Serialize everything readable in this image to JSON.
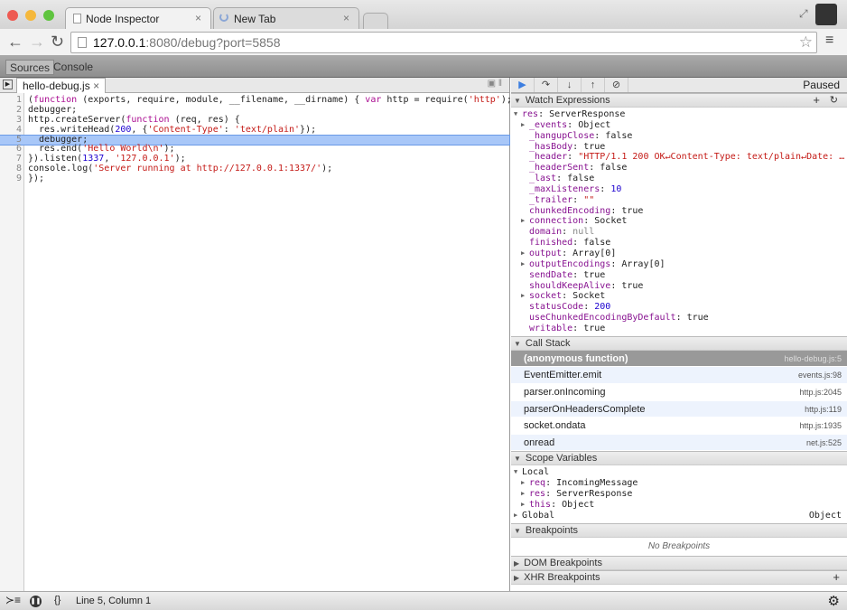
{
  "browser": {
    "tabs": [
      {
        "label": "Node Inspector",
        "active": true
      },
      {
        "label": "New Tab",
        "active": false
      }
    ],
    "url_host": "127.0.0.1",
    "url_rest": ":8080/debug?port=5858"
  },
  "devtools": {
    "panels": [
      "Sources",
      "Console"
    ],
    "file_tab": "hello-debug.js",
    "code": [
      [
        [
          "(",
          "p"
        ],
        [
          "function",
          "kw"
        ],
        [
          " (exports, require, module, __filename, __dirname) { ",
          "p"
        ],
        [
          "var",
          "kw"
        ],
        [
          " http = require(",
          "p"
        ],
        [
          "'http'",
          "str"
        ],
        [
          ");",
          "p"
        ]
      ],
      [
        [
          "debugger;",
          "p"
        ]
      ],
      [
        [
          "http.createServer(",
          "p"
        ],
        [
          "function",
          "kw"
        ],
        [
          " (req, res) {",
          "p"
        ]
      ],
      [
        [
          "  res.writeHead(",
          "p"
        ],
        [
          "200",
          "num"
        ],
        [
          ", {",
          "p"
        ],
        [
          "'Content-Type'",
          "str"
        ],
        [
          ": ",
          "p"
        ],
        [
          "'text/plain'",
          "str"
        ],
        [
          "});",
          "p"
        ]
      ],
      [
        [
          "  debugger;",
          "p"
        ]
      ],
      [
        [
          "  res.end(",
          "p"
        ],
        [
          "'Hello World\\n'",
          "str"
        ],
        [
          ");",
          "p"
        ]
      ],
      [
        [
          "}).listen(",
          "p"
        ],
        [
          "1337",
          "num"
        ],
        [
          ", ",
          "p"
        ],
        [
          "'127.0.0.1'",
          "str"
        ],
        [
          ");",
          "p"
        ]
      ],
      [
        [
          "console.log(",
          "p"
        ],
        [
          "'Server running at http://127.0.0.1:1337/'",
          "str"
        ],
        [
          ");",
          "p"
        ]
      ],
      [
        [
          "});",
          "p"
        ]
      ]
    ],
    "highlighted_line": 5,
    "status": "Paused",
    "watch": {
      "title": "Watch Expressions",
      "root": "res",
      "root_type": "ServerResponse",
      "items": [
        {
          "k": "_events",
          "v": "Object",
          "t": "obj",
          "exp": true
        },
        {
          "k": "_hangupClose",
          "v": "false",
          "t": "p"
        },
        {
          "k": "_hasBody",
          "v": "true",
          "t": "p"
        },
        {
          "k": "_header",
          "v": "\"HTTP/1.1 200 OK↵Content-Type: text/plain↵Date: …",
          "t": "str"
        },
        {
          "k": "_headerSent",
          "v": "false",
          "t": "p"
        },
        {
          "k": "_last",
          "v": "false",
          "t": "p"
        },
        {
          "k": "_maxListeners",
          "v": "10",
          "t": "num"
        },
        {
          "k": "_trailer",
          "v": "\"\"",
          "t": "str"
        },
        {
          "k": "chunkedEncoding",
          "v": "true",
          "t": "p"
        },
        {
          "k": "connection",
          "v": "Socket",
          "t": "obj",
          "exp": true
        },
        {
          "k": "domain",
          "v": "null",
          "t": "null"
        },
        {
          "k": "finished",
          "v": "false",
          "t": "p"
        },
        {
          "k": "output",
          "v": "Array[0]",
          "t": "obj",
          "exp": true
        },
        {
          "k": "outputEncodings",
          "v": "Array[0]",
          "t": "obj",
          "exp": true
        },
        {
          "k": "sendDate",
          "v": "true",
          "t": "p"
        },
        {
          "k": "shouldKeepAlive",
          "v": "true",
          "t": "p"
        },
        {
          "k": "socket",
          "v": "Socket",
          "t": "obj",
          "exp": true
        },
        {
          "k": "statusCode",
          "v": "200",
          "t": "num"
        },
        {
          "k": "useChunkedEncodingByDefault",
          "v": "true",
          "t": "p"
        },
        {
          "k": "writable",
          "v": "true",
          "t": "p"
        }
      ]
    },
    "call_stack": {
      "title": "Call Stack",
      "frames": [
        {
          "fn": "(anonymous function)",
          "loc": "hello-debug.js:5",
          "selected": true
        },
        {
          "fn": "EventEmitter.emit",
          "loc": "events.js:98"
        },
        {
          "fn": "parser.onIncoming",
          "loc": "http.js:2045"
        },
        {
          "fn": "parserOnHeadersComplete",
          "loc": "http.js:119"
        },
        {
          "fn": "socket.ondata",
          "loc": "http.js:1935"
        },
        {
          "fn": "onread",
          "loc": "net.js:525"
        }
      ]
    },
    "scope": {
      "title": "Scope Variables",
      "local": "Local",
      "vars": [
        {
          "k": "req",
          "v": "IncomingMessage"
        },
        {
          "k": "res",
          "v": "ServerResponse"
        },
        {
          "k": "this",
          "v": "Object"
        }
      ],
      "global": "Global",
      "global_value": "Object"
    },
    "breakpoints": {
      "title": "Breakpoints",
      "empty": "No Breakpoints"
    },
    "dom_breakpoints": "DOM Breakpoints",
    "xhr_breakpoints": "XHR Breakpoints",
    "status_bar": {
      "position": "Line 5, Column 1"
    }
  }
}
